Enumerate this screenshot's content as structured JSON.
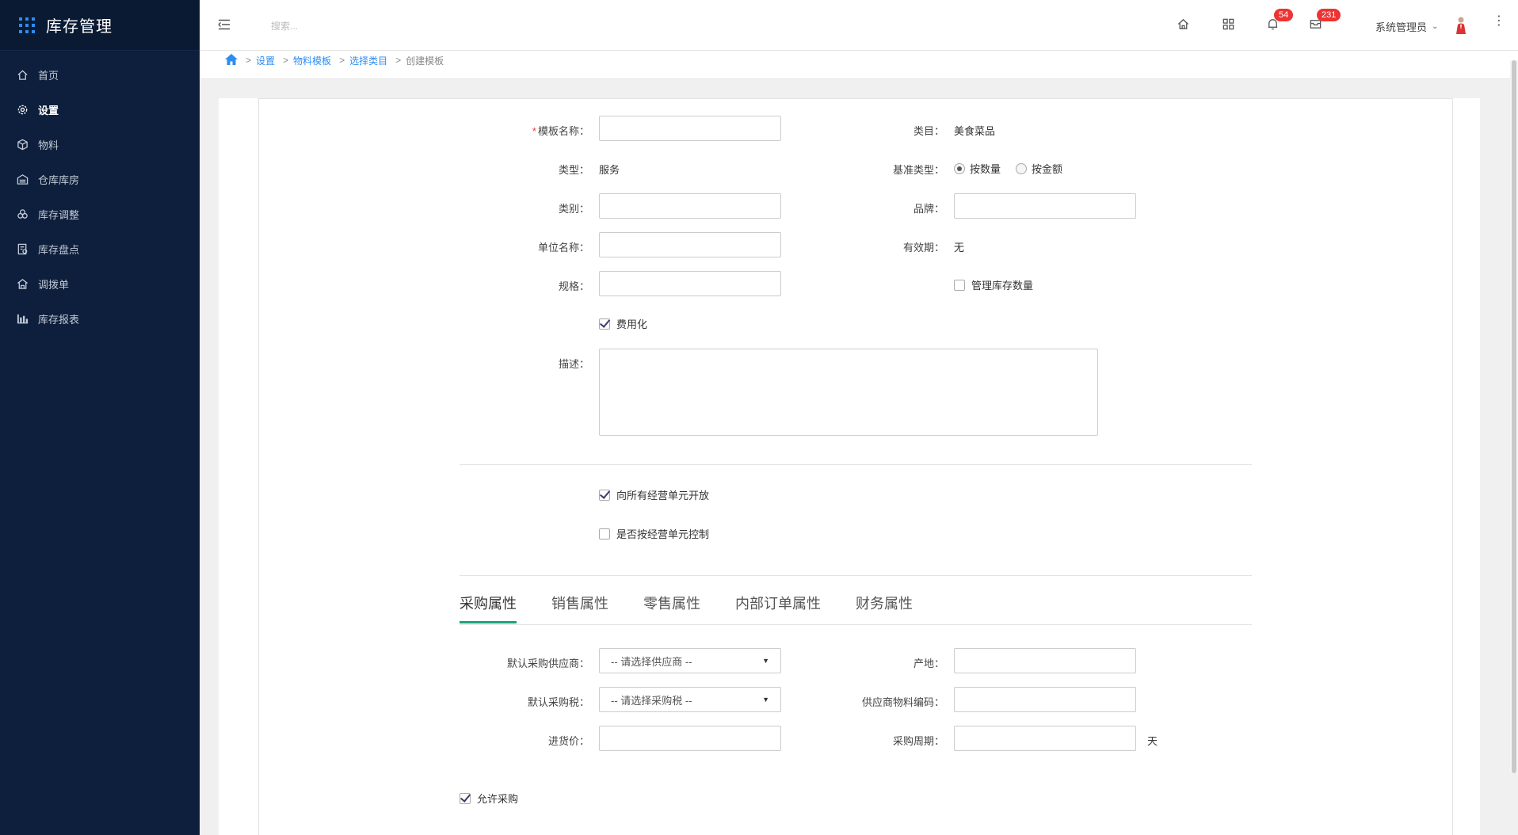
{
  "app": {
    "title": "库存管理"
  },
  "sidebar": {
    "items": [
      {
        "label": "首页",
        "icon": "home-icon"
      },
      {
        "label": "设置",
        "icon": "gear-icon"
      },
      {
        "label": "物料",
        "icon": "cube-icon"
      },
      {
        "label": "仓库库房",
        "icon": "warehouse-icon"
      },
      {
        "label": "库存调整",
        "icon": "adjust-icon"
      },
      {
        "label": "库存盘点",
        "icon": "inventory-check-icon"
      },
      {
        "label": "调拨单",
        "icon": "transfer-icon"
      },
      {
        "label": "库存报表",
        "icon": "bar-chart-icon"
      }
    ],
    "active_index": 1
  },
  "header": {
    "search_placeholder": "搜索...",
    "notifications_count": "54",
    "messages_count": "231",
    "user_name": "系统管理员"
  },
  "breadcrumb": {
    "items": [
      "设置",
      "物料模板",
      "选择类目"
    ],
    "current": "创建模板"
  },
  "form": {
    "template_name": {
      "label": "模板名称：",
      "value": ""
    },
    "category": {
      "label": "类目：",
      "value": "美食菜品"
    },
    "type": {
      "label": "类型：",
      "value": "服务"
    },
    "base_type": {
      "label": "基准类型：",
      "options": [
        "按数量",
        "按金额"
      ],
      "selected": "按数量"
    },
    "class": {
      "label": "类别：",
      "value": ""
    },
    "brand": {
      "label": "品牌：",
      "value": ""
    },
    "unit_name": {
      "label": "单位名称：",
      "value": ""
    },
    "validity": {
      "label": "有效期：",
      "value": "无"
    },
    "spec": {
      "label": "规格：",
      "value": ""
    },
    "manage_stock_qty": {
      "label": "管理库存数量",
      "checked": false
    },
    "expensed": {
      "label": "费用化",
      "checked": true
    },
    "description": {
      "label": "描述：",
      "value": ""
    },
    "open_to_all_units": {
      "label": "向所有经营单元开放",
      "checked": true
    },
    "control_by_unit": {
      "label": "是否按经营单元控制",
      "checked": false
    }
  },
  "tabs": {
    "items": [
      "采购属性",
      "销售属性",
      "零售属性",
      "内部订单属性",
      "财务属性"
    ],
    "active_index": 0
  },
  "purchase": {
    "default_supplier": {
      "label": "默认采购供应商：",
      "value": "-- 请选择供应商 --"
    },
    "origin": {
      "label": "产地：",
      "value": ""
    },
    "default_tax": {
      "label": "默认采购税：",
      "value": "-- 请选择采购税 --"
    },
    "supplier_code": {
      "label": "供应商物料编码：",
      "value": ""
    },
    "purchase_price": {
      "label": "进货价：",
      "value": ""
    },
    "purchase_cycle": {
      "label": "采购周期：",
      "value": "",
      "unit": "天"
    },
    "allow_purchase": {
      "label": "允许采购",
      "checked": true
    }
  },
  "colors": {
    "sidebar_bg": "#0d1f3c",
    "accent": "#2d8cf0",
    "tab_active": "#1aa37a",
    "badge": "#ee3333"
  }
}
